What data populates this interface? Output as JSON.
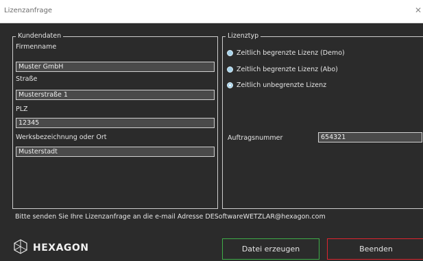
{
  "window": {
    "title": "Lizenzanfrage",
    "close_glyph": "✕"
  },
  "customer": {
    "legend": "Kundendaten",
    "fields": [
      {
        "label": "Firmenname",
        "value": "Muster GmbH"
      },
      {
        "label": "Straße",
        "value": "Musterstraße 1"
      },
      {
        "label": "PLZ",
        "value": "12345"
      },
      {
        "label": "Werksbezeichnung oder Ort",
        "value": "Musterstadt"
      }
    ]
  },
  "license": {
    "legend": "Lizenztyp",
    "options": [
      {
        "label": "Zeitlich begrenzte Lizenz (Demo)",
        "checked": false
      },
      {
        "label": "Zeitlich begrenzte Lizenz (Abo)",
        "checked": false
      },
      {
        "label": "Zeitlich unbegrenzte Lizenz",
        "checked": true
      }
    ],
    "order_label": "Auftragsnummer",
    "order_value": "654321"
  },
  "info_text": "Bitte senden Sie Ihre Lizenzanfrage an die e-mail Adresse DESoftwareWETZLAR@hexagon.com",
  "logo": {
    "text": "HEXAGON",
    "icon": "hexagon-logo-icon"
  },
  "buttons": {
    "create": "Datei erzeugen",
    "exit": "Beenden"
  },
  "colors": {
    "background": "#2b2b2b",
    "create_border": "#3fae49",
    "exit_border": "#e0252f",
    "radio_fill": "#a7d2e9"
  }
}
